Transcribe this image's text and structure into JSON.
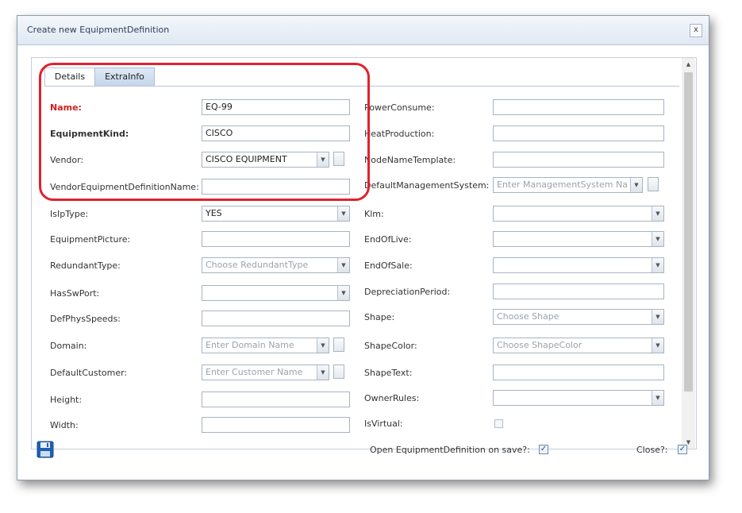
{
  "dialog": {
    "title": "Create new EquipmentDefinition",
    "close_label": "x"
  },
  "tabs": [
    {
      "label": "Details"
    },
    {
      "label": "ExtraInfo"
    }
  ],
  "left_fields": [
    {
      "label": "Name:",
      "value": "EQ-99"
    },
    {
      "label": "EquipmentKind:",
      "value": "CISCO"
    },
    {
      "label": "Vendor:",
      "value": "CISCO EQUIPMENT"
    },
    {
      "label": "VendorEquipmentDefinitionName:",
      "value": ""
    },
    {
      "label": "IsIpType:",
      "value": "YES"
    },
    {
      "label": "EquipmentPicture:",
      "value": ""
    },
    {
      "label": "RedundantType:",
      "placeholder": "Choose RedundantType"
    },
    {
      "label": "HasSwPort:",
      "value": ""
    },
    {
      "label": "DefPhysSpeeds:",
      "value": ""
    },
    {
      "label": "Domain:",
      "placeholder": "Enter Domain Name"
    },
    {
      "label": "DefaultCustomer:",
      "placeholder": "Enter Customer Name"
    },
    {
      "label": "Height:",
      "value": ""
    },
    {
      "label": "Width:",
      "value": ""
    }
  ],
  "right_fields": [
    {
      "label": "PowerConsume:",
      "value": ""
    },
    {
      "label": "HeatProduction:",
      "value": ""
    },
    {
      "label": "NodeNameTemplate:",
      "value": ""
    },
    {
      "label": "DefaultManagementSystem:",
      "placeholder": "Enter ManagementSystem Na"
    },
    {
      "label": "Klm:",
      "value": ""
    },
    {
      "label": "EndOfLive:",
      "value": ""
    },
    {
      "label": "EndOfSale:",
      "value": ""
    },
    {
      "label": "DepreciationPeriod:",
      "value": ""
    },
    {
      "label": "Shape:",
      "placeholder": "Choose Shape"
    },
    {
      "label": "ShapeColor:",
      "placeholder": "Choose ShapeColor"
    },
    {
      "label": "ShapeText:",
      "value": ""
    },
    {
      "label": "OwnerRules:",
      "value": ""
    },
    {
      "label": "IsVirtual:",
      "checked": false
    }
  ],
  "footer": {
    "open_on_save_label": "Open EquipmentDefinition on save?:",
    "open_on_save_checked": true,
    "close_label": "Close?:",
    "close_checked": true,
    "check_glyph": "✓"
  },
  "icons": {
    "dropdown": "▼",
    "scroll_up": "▲",
    "scroll_down": "▼"
  },
  "colors": {
    "required_label": "#d22020",
    "highlight": "#e0222e",
    "save_icon": "#1f5fb4"
  }
}
